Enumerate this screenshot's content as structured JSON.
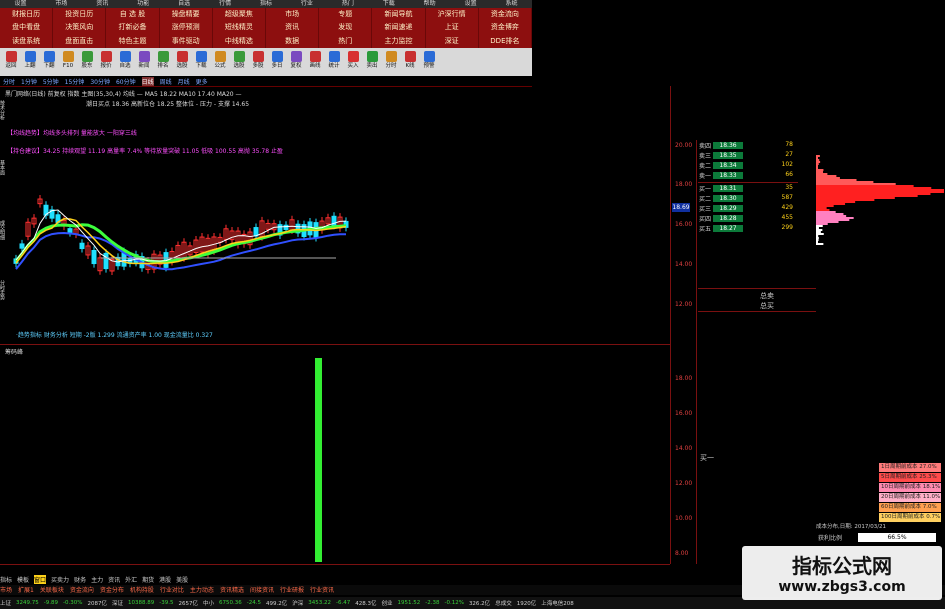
{
  "menubar": [
    "设置",
    "市场",
    "资讯",
    "功能",
    "自选",
    "行情",
    "指标",
    "行业",
    "热门",
    "下载",
    "帮助",
    "设置",
    "系统"
  ],
  "quick": [
    "财报日历",
    "投资日历",
    "自 选 股",
    "操盘精要",
    "超级聚焦",
    "市场",
    "专题",
    "新闻导航",
    "沪深行情",
    "资金流向",
    "盘中看盘",
    "决策风向",
    "打新必备",
    "涨停预测",
    "短线精灵",
    "资讯",
    "发现",
    "新闻速递",
    "上证",
    "资金博弈",
    "读盘系统",
    "盘面直击",
    "特色主题",
    "事件驱动",
    "中线精选",
    "数据",
    "热门",
    "主力监控",
    "深证",
    "DDE排名"
  ],
  "toolbar": [
    "返回",
    "上翻",
    "下翻",
    "F10",
    "股东",
    "报价",
    "自选",
    "新闻",
    "排名",
    "选股",
    "下载",
    "公式",
    "选股",
    "多股",
    "多日",
    "复权",
    "画线",
    "统计",
    "买入",
    "卖出",
    "分时",
    "K线",
    "预警"
  ],
  "periods": [
    "分时",
    "1分钟",
    "5分钟",
    "15分钟",
    "30分钟",
    "60分钟",
    "日线",
    "周线",
    "月线",
    "更多"
  ],
  "active_period": "日线",
  "info": {
    "line1": "黑门网络(日线) 前复权 指数 主图(35,30,4) 均线 —  MA5 18.22  MA10 17.40  MA20 —",
    "line2": "潮日买点 18.36 高新位仓 18.25 整体位 - 压力 - 支撑 14.65",
    "line3": "【均线趋势】均线多头排列  量能放大  一阳穿三线",
    "line4": "【持仓建议】34.25 持续观望 11.19 高量率 7.4% 等待放量突破 11.05 低吸 100.55 高抛 35.78 止盈",
    "line5": "·趋势指标 财务分析 短期 -2版 1.299  流通资产率 1.00  现金流量比 0.327",
    "sub": "筹码峰"
  },
  "axis_labels": [
    "20.00",
    "18.00",
    "16.00",
    "14.00",
    "12.00",
    "18.00",
    "16.00",
    "14.00",
    "12.00",
    "10.00",
    "8.00",
    "6.00"
  ],
  "current_price": "18.69",
  "order_book": {
    "sell": [
      {
        "label": "卖四",
        "price": "18.36",
        "vol": "78"
      },
      {
        "label": "卖三",
        "price": "18.35",
        "vol": "27"
      },
      {
        "label": "卖二",
        "price": "18.34",
        "vol": "102"
      },
      {
        "label": "卖一",
        "price": "18.33",
        "vol": "66"
      }
    ],
    "buy": [
      {
        "label": "买一",
        "price": "18.31",
        "vol": "35"
      },
      {
        "label": "买二",
        "price": "18.30",
        "vol": "587"
      },
      {
        "label": "买三",
        "price": "18.29",
        "vol": "429"
      },
      {
        "label": "买四",
        "price": "18.28",
        "vol": "455"
      },
      {
        "label": "买五",
        "price": "18.27",
        "vol": "299"
      }
    ],
    "total_sell": "总卖",
    "total_buy": "总买",
    "buy_label": "买一"
  },
  "chip_legend": [
    {
      "text": "1日周期前成本 27.0%",
      "color": "#ff7a7a"
    },
    {
      "text": "5日周期前成本 25.3%",
      "color": "#ff4a4a"
    },
    {
      "text": "10日周期前成本 18.1%",
      "color": "#ff8ab0"
    },
    {
      "text": "20日周期前成本 11.0%",
      "color": "#ffb0c8"
    },
    {
      "text": "60日周期前成本 7.0%",
      "color": "#ffa050"
    },
    {
      "text": "100日周期前成本 0.7%",
      "color": "#ffd060"
    }
  ],
  "cost_line": "成本分布,日期: 2017/03/21",
  "profit": {
    "label": "获利比例",
    "value": "66.5%"
  },
  "tabs1": [
    "指标",
    "模板",
    "窗口",
    "买卖力",
    "财务",
    "主力",
    "资讯",
    "外汇",
    "期货",
    "港股",
    "美股"
  ],
  "tabs1_selected": "窗口",
  "tabs2": [
    "市场",
    "扩展1",
    "关联板块",
    "资金流向",
    "资金分布",
    "机构持股",
    "行业对比",
    "主力动态",
    "资讯精选",
    "间接资讯",
    "行业研报",
    "行业资讯"
  ],
  "status": [
    {
      "t": "上证",
      "c": "n"
    },
    {
      "t": "3249.75",
      "c": "dn"
    },
    {
      "t": "-9.89",
      "c": "dn"
    },
    {
      "t": "-0.30%",
      "c": "dn"
    },
    {
      "t": "2087亿",
      "c": "n"
    },
    {
      "t": "深证",
      "c": "n"
    },
    {
      "t": "10388.89",
      "c": "dn"
    },
    {
      "t": "-39.5",
      "c": "dn"
    },
    {
      "t": "2657亿",
      "c": "n"
    },
    {
      "t": "中小",
      "c": "n"
    },
    {
      "t": "6750.36",
      "c": "dn"
    },
    {
      "t": "-24.5",
      "c": "dn"
    },
    {
      "t": "499.2亿",
      "c": "n"
    },
    {
      "t": "沪深",
      "c": "n"
    },
    {
      "t": "3453.22",
      "c": "dn"
    },
    {
      "t": "-6.47",
      "c": "dn"
    },
    {
      "t": "428.3亿",
      "c": "n"
    },
    {
      "t": "创业",
      "c": "n"
    },
    {
      "t": "1951.52",
      "c": "dn"
    },
    {
      "t": "-2.38",
      "c": "dn"
    },
    {
      "t": "-0.12%",
      "c": "dn"
    },
    {
      "t": "326.2亿",
      "c": "n"
    },
    {
      "t": "总成交",
      "c": "n"
    },
    {
      "t": "1920亿",
      "c": "n"
    },
    {
      "t": "上海电信208",
      "c": "n"
    }
  ],
  "watermark": {
    "title": "指标公式网",
    "url": "www.zbgs3.com"
  },
  "lefttabs": [
    "技术分析",
    "基本面",
    "成交明细",
    "分时走势"
  ],
  "colors": {
    "bull": "#ff3030",
    "bear": "#20e0ff",
    "ma_green": "#3cff3c",
    "ma_yellow": "#ffd21a",
    "ma_blue": "#3050ff",
    "ma_white": "#ffffff",
    "volume_bar": "#33ee33"
  }
}
